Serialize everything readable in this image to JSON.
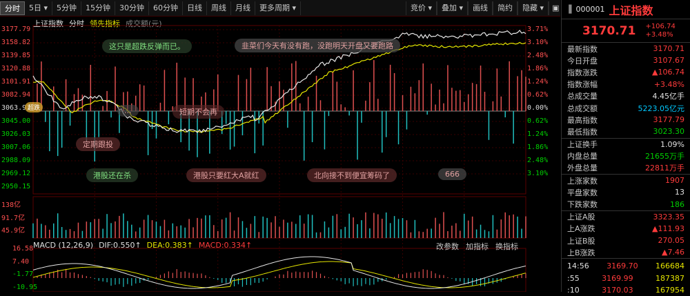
{
  "tabs": [
    "分时",
    "5日",
    "5分钟",
    "15分钟",
    "30分钟",
    "60分钟",
    "日线",
    "周线",
    "月线",
    "更多周期"
  ],
  "right_tools": [
    "竞价",
    "叠加",
    "画线",
    "简约",
    "隐藏"
  ],
  "legend": {
    "index": "上证指数",
    "fenshi": "分时",
    "leading": "领先指标",
    "amount": "成交额(元)"
  },
  "price_axis": [
    "3177.79",
    "3158.82",
    "3139.85",
    "3120.88",
    "3101.91",
    "3082.94",
    "3063.97",
    "3045.00",
    "3026.03",
    "3007.06",
    "2988.09",
    "2969.12",
    "2950.15"
  ],
  "pct_axis": [
    "3.71%",
    "3.10%",
    "2.48%",
    "1.86%",
    "1.24%",
    "0.62%",
    "0.00%",
    "0.62%",
    "1.24%",
    "1.86%",
    "2.48%",
    "3.10%"
  ],
  "vol_axis": [
    "138亿",
    "91.7亿",
    "45.9亿"
  ],
  "macd_axis": [
    "16.58",
    "7.40",
    "-1.77",
    "-10.95"
  ],
  "bubbles": [
    {
      "text": "这只是超跌反弹而已。",
      "color": "#e08080"
    },
    {
      "text": "韭菜们今天有没有跑，没跑明天开盘又要跑路",
      "color": "#c8c8c8"
    },
    {
      "text": "...",
      "color": "#c8c8c8"
    },
    {
      "text": "定期跟投",
      "color": "#e08080"
    },
    {
      "text": "短期不会再",
      "color": "#e08080"
    },
    {
      "text": "港股还在杀",
      "color": "#80e080"
    },
    {
      "text": "港股只要红大A就红",
      "color": "#e08080"
    },
    {
      "text": "北向接不到便宜筹码了",
      "color": "#e08080"
    },
    {
      "text": "666",
      "color": "#c8c8c8"
    },
    {
      "text": "超跌",
      "color": "#e0e0e0"
    }
  ],
  "macd": {
    "name": "MACD",
    "params": "(12,26,9)",
    "dif": "DIF:0.550↑",
    "dea": "DEA:0.383↑",
    "macd": "MACD:0.334↑",
    "buttons": [
      "改参数",
      "加指标",
      "换指标"
    ]
  },
  "panel": {
    "code": "000001",
    "name": "上证指数",
    "price": "3170.71",
    "change": "+106.74",
    "change_pct": "+3.48%",
    "rows1": [
      {
        "label": "最新指数",
        "value": "3170.71",
        "color": "red"
      },
      {
        "label": "今日开盘",
        "value": "3107.67",
        "color": "red"
      },
      {
        "label": "指数涨跌",
        "value": "▲106.74",
        "color": "red"
      },
      {
        "label": "指数涨幅",
        "value": "+3.48%",
        "color": "red"
      },
      {
        "label": "总成交量",
        "value": "4.45亿手",
        "color": "white"
      },
      {
        "label": "总成交额",
        "value": "5223.05亿元",
        "color": "cyan"
      },
      {
        "label": "最高指数",
        "value": "3177.79",
        "color": "red"
      },
      {
        "label": "最低指数",
        "value": "3023.30",
        "color": "green"
      }
    ],
    "rows2": [
      {
        "label": "上证换手",
        "value": "1.09%",
        "color": "white"
      },
      {
        "label": "内盘总量",
        "value": "21655万手",
        "color": "green"
      },
      {
        "label": "外盘总量",
        "value": "22811万手",
        "color": "red"
      }
    ],
    "rows3": [
      {
        "label": "上涨家数",
        "value": "1907",
        "color": "red"
      },
      {
        "label": "平盘家数",
        "value": "13",
        "color": "white"
      },
      {
        "label": "下跌家数",
        "value": "186",
        "color": "green"
      }
    ],
    "rows4": [
      {
        "label": "上证A股",
        "value": "3323.35",
        "color": "red"
      },
      {
        "label": "上A涨跌",
        "value": "▲111.93",
        "color": "red"
      },
      {
        "label": "上证B股",
        "value": "270.05",
        "color": "red"
      },
      {
        "label": "上B涨跌",
        "value": "▲7.46",
        "color": "red"
      }
    ],
    "ticks": [
      {
        "time": "14:56",
        "price": "3169.70",
        "vol": "166684"
      },
      {
        "time": ":55",
        "price": "3169.99",
        "vol": "187387"
      },
      {
        "time": ":10",
        "price": "3170.03",
        "vol": "167954"
      }
    ]
  }
}
